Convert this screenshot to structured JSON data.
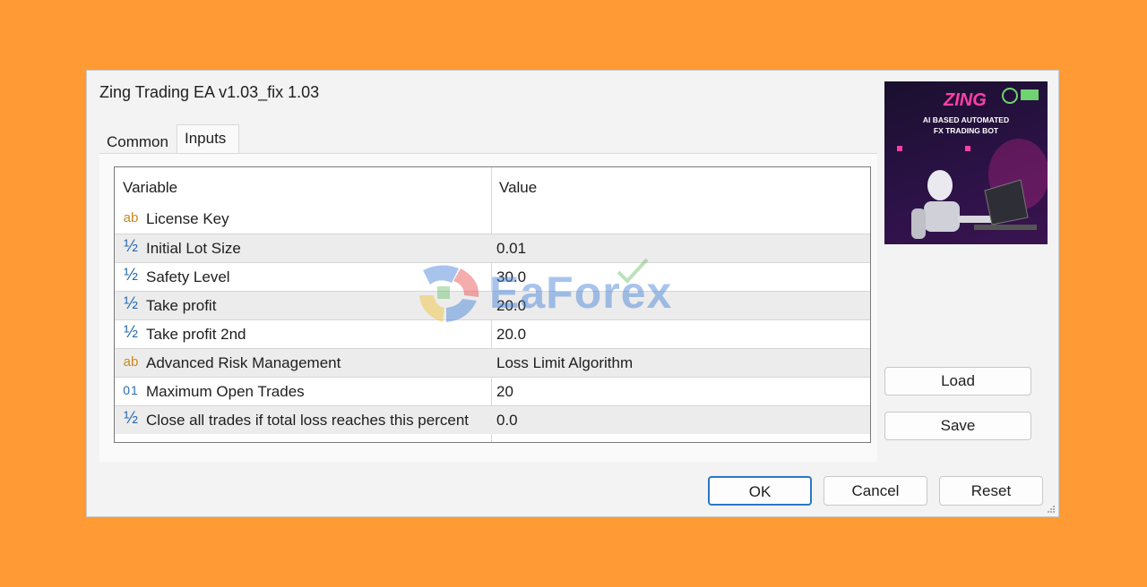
{
  "window": {
    "title": "Zing Trading EA v1.03_fix 1.03"
  },
  "tabs": [
    {
      "label": "Common"
    },
    {
      "label": "Inputs"
    }
  ],
  "table": {
    "headers": {
      "variable": "Variable",
      "value": "Value"
    },
    "rows": [
      {
        "type": "ab",
        "type_icon": "string-type-icon",
        "variable": "License Key",
        "value": ""
      },
      {
        "type": "½",
        "type_icon": "double-type-icon",
        "variable": "Initial Lot Size",
        "value": "0.01"
      },
      {
        "type": "½",
        "type_icon": "double-type-icon",
        "variable": "Safety Level",
        "value": "30.0"
      },
      {
        "type": "½",
        "type_icon": "double-type-icon",
        "variable": "Take profit",
        "value": "20.0"
      },
      {
        "type": "½",
        "type_icon": "double-type-icon",
        "variable": "Take profit 2nd",
        "value": "20.0"
      },
      {
        "type": "ab",
        "type_icon": "string-type-icon",
        "variable": "Advanced Risk Management",
        "value": "Loss Limit Algorithm"
      },
      {
        "type": "01",
        "type_icon": "integer-type-icon",
        "variable": "Maximum  Open Trades",
        "value": "20"
      },
      {
        "type": "½",
        "type_icon": "double-type-icon",
        "variable": "Close all trades if total loss reaches this percent",
        "value": "0.0"
      }
    ]
  },
  "preview": {
    "brand": "ZING",
    "line1": "AI BASED AUTOMATED",
    "line2": "FX TRADING BOT"
  },
  "side_buttons": {
    "load": "Load",
    "save": "Save"
  },
  "footer_buttons": {
    "ok": "OK",
    "cancel": "Cancel",
    "reset": "Reset"
  },
  "watermark": {
    "text": "EaForex"
  },
  "colors": {
    "background": "#FF9A34",
    "dialog": "#F3F3F3",
    "ok_border": "#2B77C6",
    "string_icon": "#C98A1E",
    "numeric_icon": "#2A6CB0"
  }
}
